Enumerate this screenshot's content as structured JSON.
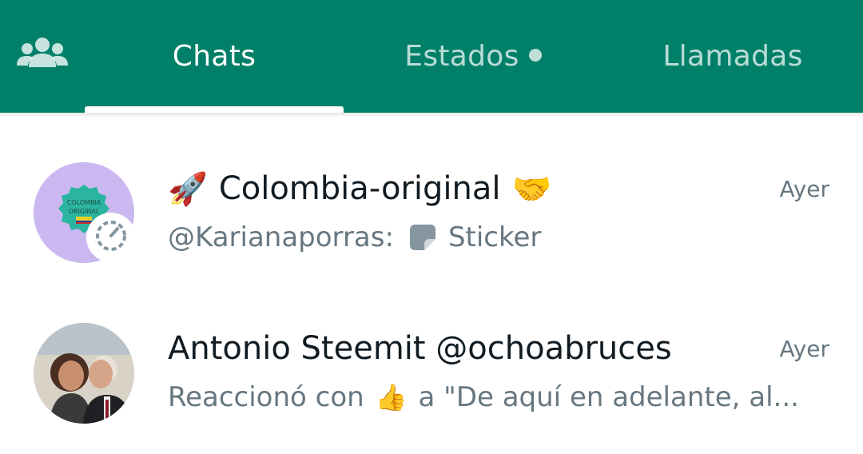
{
  "tabs": {
    "community_icon": "community-icon",
    "chats": "Chats",
    "status": "Estados",
    "calls": "Llamadas",
    "active": "chats"
  },
  "colors": {
    "header": "#008069",
    "primary_text": "#111b21",
    "secondary_text": "#667781",
    "avatar1_bg": "#cbb8f0"
  },
  "chats": [
    {
      "name": "Colombia-original",
      "emoji_before": "🚀",
      "emoji_after": "🤝",
      "time": "Ayer",
      "preview_sender": "@Karianaporras:",
      "preview_icon": "sticker-icon",
      "preview_text": "Sticker",
      "avatar_label": "COLOMBIA ORIGINAL"
    },
    {
      "name": "Antonio Steemit @ochoabruces",
      "time": "Ayer",
      "preview_prefix": "Reaccionó con",
      "preview_emoji": "👍",
      "preview_text": "a \"De aquí en adelante, al..."
    }
  ]
}
